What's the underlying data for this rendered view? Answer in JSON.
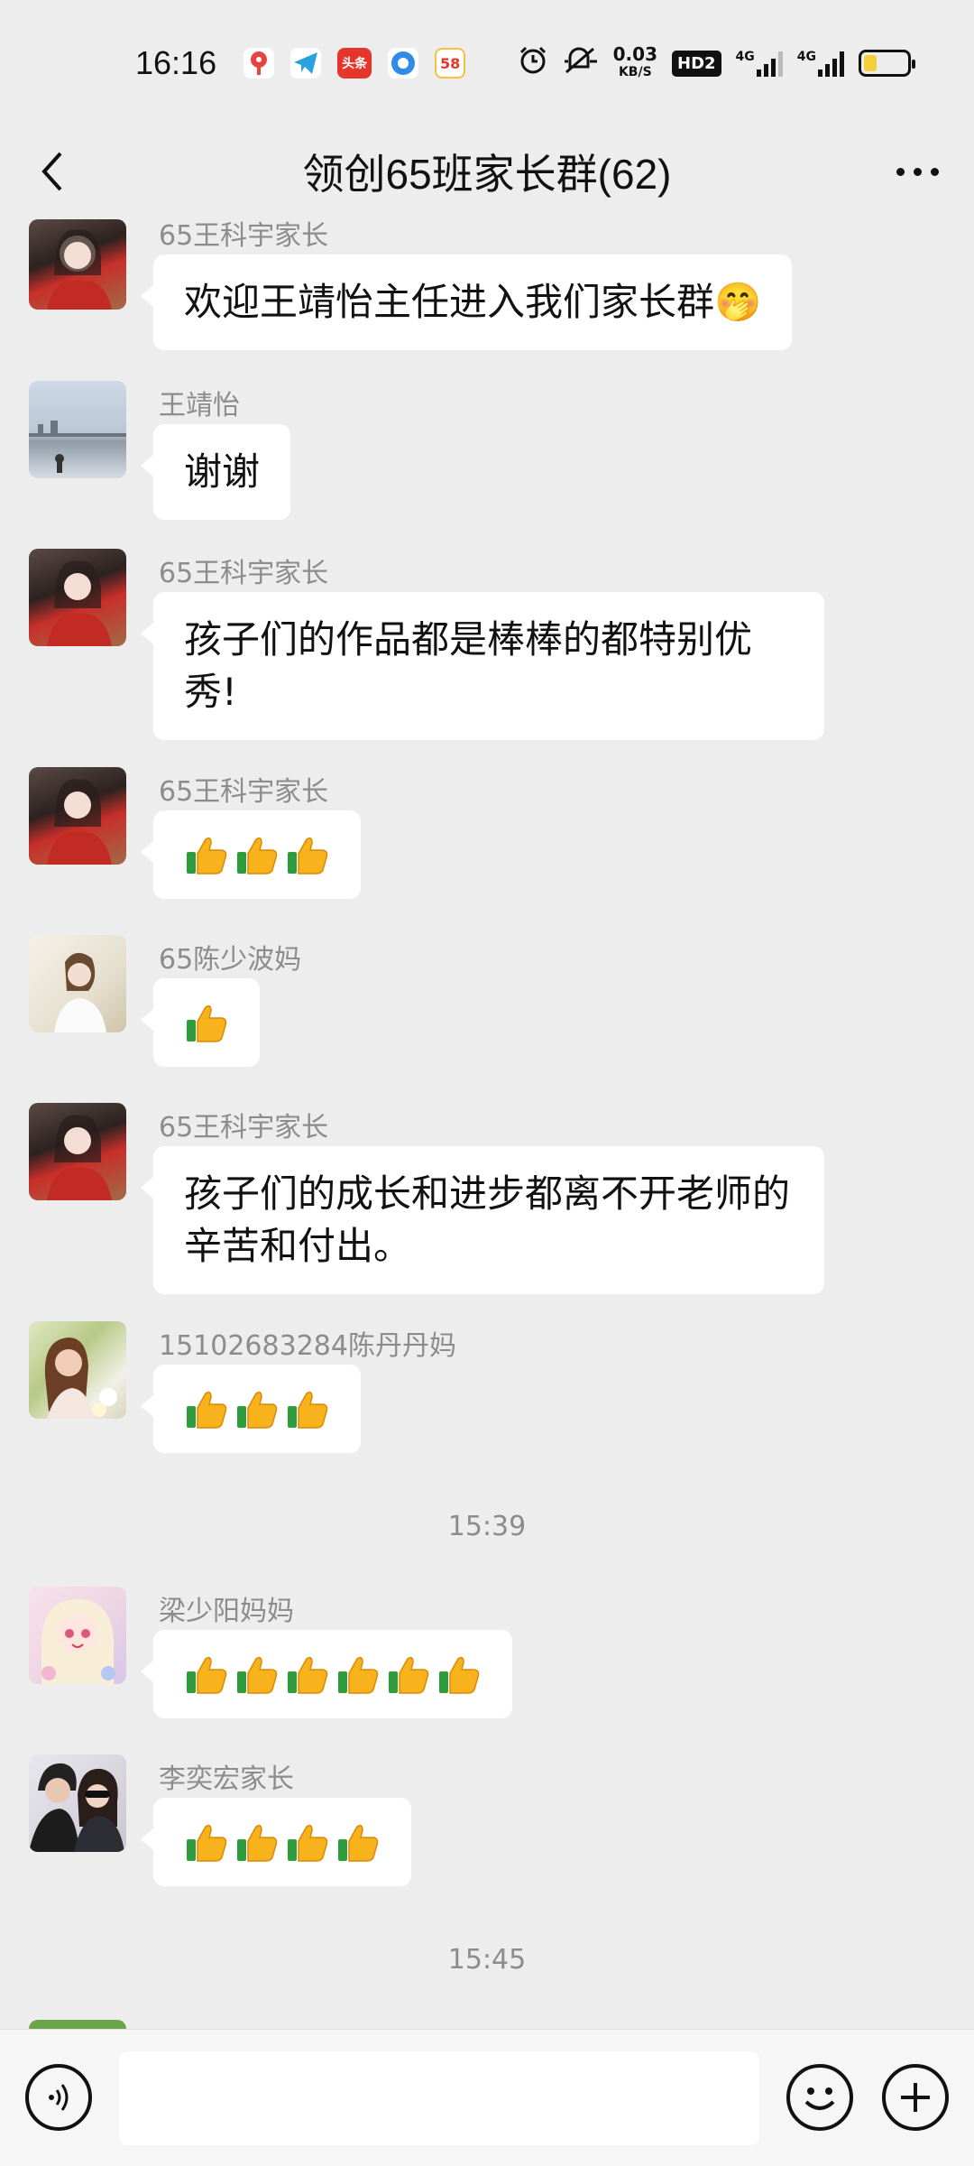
{
  "status_bar": {
    "time": "16:16",
    "apps": [
      {
        "icon": "maps-icon",
        "label": "",
        "color": "#e64340"
      },
      {
        "icon": "telegram-icon",
        "label": "",
        "color": "#2aa1e0"
      },
      {
        "icon": "toutiao-icon",
        "label": "头条",
        "color": "#e4362b"
      },
      {
        "icon": "browser-icon",
        "label": "",
        "color": "#2e8ce6"
      },
      {
        "icon": "58-icon",
        "label": "58",
        "color": "#f6c23e"
      }
    ],
    "speed_value": "0.03",
    "speed_unit": "KB/S",
    "hd_label": "HD2",
    "network1": "4G",
    "network2": "4G",
    "battery_level": 0.3
  },
  "header": {
    "title": "领创65班家长群(62)"
  },
  "messages": [
    {
      "sender": "65王科宇家长",
      "text": "欢迎王靖怡主任进入我们家长群🤭",
      "avatar": "avatar-girl-red-scarf",
      "thumbs": 0
    },
    {
      "sender": "王靖怡",
      "text": "谢谢",
      "avatar": "avatar-lake",
      "thumbs": 0
    },
    {
      "sender": "65王科宇家长",
      "text": "孩子们的作品都是棒棒的都特别优秀!",
      "avatar": "avatar-girl-red-scarf",
      "thumbs": 0
    },
    {
      "sender": "65王科宇家长",
      "text": "",
      "avatar": "avatar-girl-red-scarf",
      "thumbs": 3
    },
    {
      "sender": "65陈少波妈",
      "text": "",
      "avatar": "avatar-girl-white",
      "thumbs": 1
    },
    {
      "sender": "65王科宇家长",
      "text": "孩子们的成长和进步都离不开老师的辛苦和付出。",
      "avatar": "avatar-girl-red-scarf",
      "thumbs": 0
    },
    {
      "sender": "15102683284陈丹丹妈",
      "text": "",
      "avatar": "avatar-woman-flowers",
      "thumbs": 3
    },
    {
      "divider": "15:39"
    },
    {
      "sender": "梁少阳妈妈",
      "text": "",
      "avatar": "avatar-anime-girl",
      "thumbs": 6
    },
    {
      "sender": "李奕宏家长",
      "text": "",
      "avatar": "avatar-couple",
      "thumbs": 4
    },
    {
      "divider": "15:45"
    }
  ],
  "input_bar": {
    "placeholder": ""
  },
  "colors": {
    "background": "#ededed",
    "bubble": "#ffffff",
    "sender_text": "#8c8c8c"
  }
}
